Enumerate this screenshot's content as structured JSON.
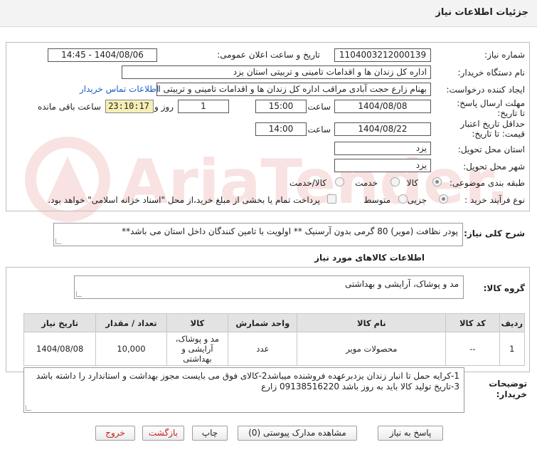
{
  "header": {
    "title": "جزئیات اطلاعات نیاز"
  },
  "form": {
    "need_number_label": "شماره نیاز:",
    "need_number": "1104003212000139",
    "announce_label": "تاریخ و ساعت اعلان عمومی:",
    "announce_value": "1404/08/06 - 14:45",
    "buyer_org_label": "نام دستگاه خریدار:",
    "buyer_org": "اداره کل زندان ها و اقدامات تامینی و تربیتی استان یزد",
    "creator_label": "ایجاد کننده درخواست:",
    "creator": "بهنام زارع حجت آبادی مراقب اداره کل زندان ها و اقدامات تامینی و تربیتی استان یزد",
    "contact_link": "اطلاعات تماس خریدار",
    "send_deadline_label": "مهلت ارسال پاسخ: تا تاریخ:",
    "send_deadline_date": "1404/08/08",
    "time_label": "ساعت",
    "send_deadline_time": "15:00",
    "days_count": "1",
    "days_and_label": "روز و",
    "remaining_time": "23:10:17",
    "remaining_label": "ساعت باقی مانده",
    "validity_label": "حداقل تاریخ اعتبار قیمت: تا تاریخ:",
    "validity_date": "1404/08/22",
    "validity_time": "14:00",
    "province_label": "استان محل تحویل:",
    "province": "یزد",
    "city_label": "شهر محل تحویل:",
    "city": "یزد",
    "category_label": "طبقه بندی موضوعی:",
    "category_options": [
      "کالا",
      "خدمت",
      "کالا/خدمت"
    ],
    "category_selected": "کالا",
    "process_label": "نوع فرآیند خرید :",
    "process_options": [
      "جزیی",
      "متوسط"
    ],
    "process_selected": "جزیی",
    "payment_note": "پرداخت تمام یا بخشی از مبلغ خرید،از محل \"اسناد خزانه اسلامی\" خواهد بود."
  },
  "description": {
    "label": "شرح کلی نیاز:",
    "text": "پودر نظافت (مویر) 80 گرمی بدون آرسنیک  **  اولویت با تامین کنندگان داخل استان می باشد**"
  },
  "goods_section": {
    "title": "اطلاعات کالاهای مورد نیاز",
    "group_label": "گروه کالا:",
    "group_value": "مد و پوشاک، آرایشی و بهداشتی"
  },
  "table": {
    "headers": [
      "ردیف",
      "کد کالا",
      "نام کالا",
      "واحد شمارش",
      "کالا",
      "تعداد / مقدار",
      "تاریخ نیاز"
    ],
    "rows": [
      [
        "1",
        "--",
        "محصولات مویر",
        "عدد",
        "مد و پوشاک، آرایشی و بهداشتی",
        "10,000",
        "1404/08/08"
      ]
    ]
  },
  "buyer_notes": {
    "label": "توضیحات خریدار:",
    "text": "1-کرایه حمل تا انبار زندان یزدبرعهده فروشنده میباشد2-کالای فوق می بایست مجوز بهداشت و استاندارد را داشته باشد 3-تاریخ تولید کالا باید به روز باشد 09138516220 زارع"
  },
  "buttons": {
    "respond": "پاسخ به نیاز",
    "view_docs": "مشاهده مدارک پیوستی (0)",
    "print": "چاپ",
    "back": "بازگشت",
    "exit": "خروج"
  },
  "watermark_text": "AriaTender.net",
  "colors": {
    "link": "#1a5fc7",
    "timer_bg": "#f6efb4",
    "exit_text": "#c42121",
    "watermark": "#cc2a2a"
  }
}
